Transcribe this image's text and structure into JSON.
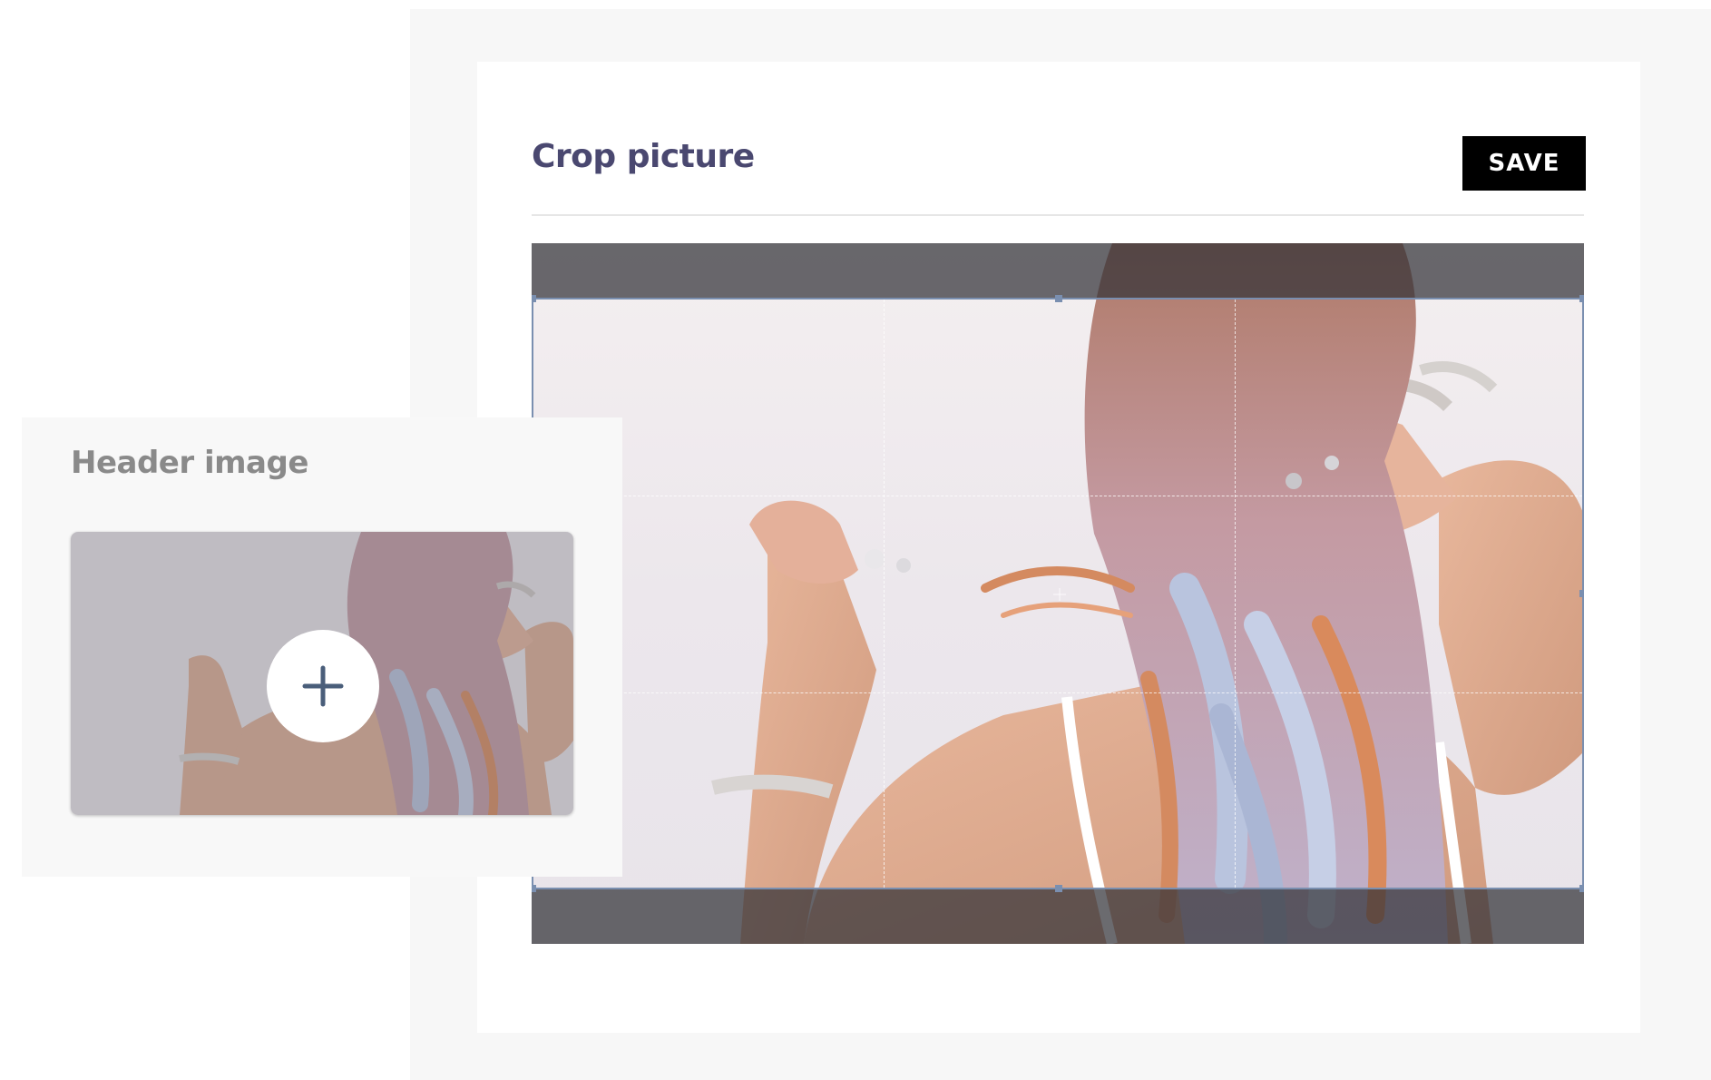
{
  "crop_dialog": {
    "title": "Crop picture",
    "save_label": "SAVE"
  },
  "header_card": {
    "title": "Header image",
    "add_icon": "plus-icon"
  },
  "colors": {
    "title": "#4a4870",
    "save_bg": "#000000",
    "crop_border": "#7a8fb0",
    "dim_overlay": "#323237"
  }
}
